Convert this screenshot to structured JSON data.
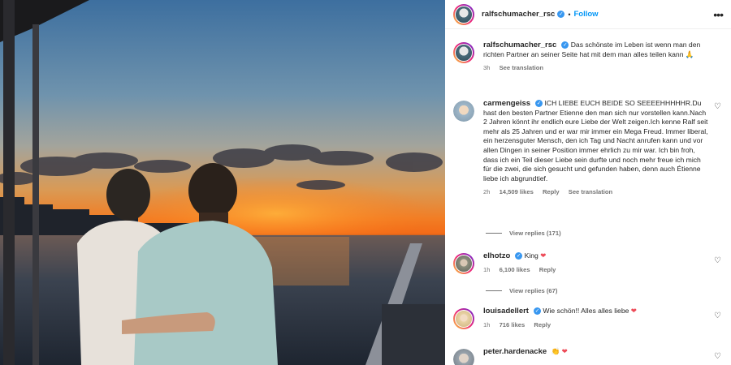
{
  "post": {
    "username": "ralfschumacher_rsc",
    "follow_label": "Follow",
    "more_label": "•••",
    "verified_glyph": "✓",
    "dot": "•"
  },
  "caption": {
    "username": "ralfschumacher_rsc",
    "text": "Das schönste im Leben ist wenn man den richten Partner an seiner Seite hat mit dem man alles teilen kann 🙏",
    "time": "3h",
    "see_translation": "See translation"
  },
  "comments": [
    {
      "username": "carmengeiss",
      "text": "ICH LIEBE EUCH BEIDE SO SEEEEHHHHHR.Du hast den besten Partner Etienne den man sich nur vorstellen kann.Nach 2 Jahren könnt ihr endlich eure Liebe der Welt zeigen.Ich kenne Ralf seit mehr als 25 Jahren und er war mir immer ein Mega Freud. Immer liberal, ein herzensguter Mensch, den ich Tag und Nacht anrufen kann und vor allen Dingen in seiner Position immer ehrlich zu mir war. Ich bin froh, dass ich ein Teil dieser Liebe sein durfte und noch mehr freue ich mich für die zwei, die sich gesucht und gefunden haben, denn auch Étienne liebe ich abgrundtief.",
      "time": "2h",
      "likes": "14,509 likes",
      "reply": "Reply",
      "see_translation": "See translation",
      "view_replies": "View replies (171)"
    },
    {
      "username": "elhotzo",
      "text": "King",
      "emoji": "❤",
      "time": "1h",
      "likes": "6,100 likes",
      "reply": "Reply",
      "view_replies": "View replies (67)"
    },
    {
      "username": "louisadellert",
      "text": "Wie schön!! Alles alles liebe",
      "emoji": "❤",
      "time": "1h",
      "likes": "716 likes",
      "reply": "Reply"
    },
    {
      "username": "peter.hardenacke",
      "text": "",
      "emoji": "👏 ❤",
      "time": "",
      "likes": "",
      "reply": ""
    }
  ],
  "icons": {
    "heart": "♡"
  },
  "colors": {
    "accent": "#0095f6",
    "verified": "#3897f0",
    "like_red": "#ed4956"
  }
}
